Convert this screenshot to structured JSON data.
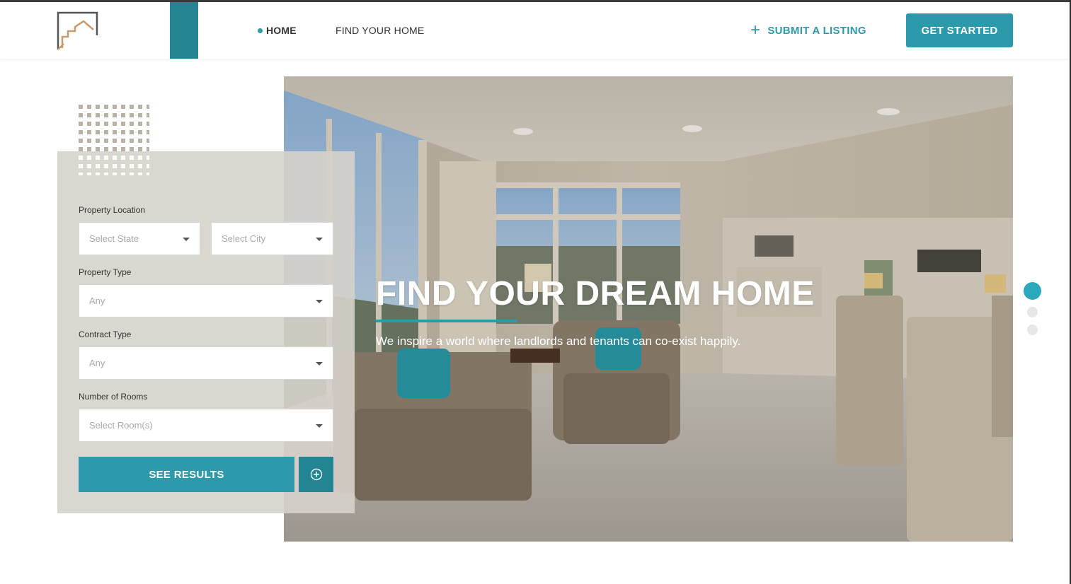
{
  "header": {
    "nav": {
      "home": "HOME",
      "find_your_home": "FIND YOUR HOME"
    },
    "submit_listing": "SUBMIT A LISTING",
    "get_started": "GET STARTED"
  },
  "hero": {
    "title": "FIND YOUR DREAM HOME",
    "subtitle": "We inspire a world where landlords and tenants can co-exist happily."
  },
  "search_form": {
    "property_location_label": "Property Location",
    "state_placeholder": "Select State",
    "city_placeholder": "Select City",
    "property_type_label": "Property Type",
    "property_type_value": "Any",
    "contract_type_label": "Contract Type",
    "contract_type_value": "Any",
    "rooms_label": "Number of Rooms",
    "rooms_placeholder": "Select Room(s)",
    "submit": "SEE RESULTS"
  },
  "carousel": {
    "slide_count": 3,
    "active_slide": 1
  },
  "colors": {
    "accent": "#2d9aab",
    "accent_dark": "#238594",
    "panel": "#d6d2cb"
  },
  "icons": {
    "logo": "house-outline-logo",
    "plus": "plus-icon",
    "more": "plus-circle-icon",
    "caret": "caret-down-icon"
  }
}
